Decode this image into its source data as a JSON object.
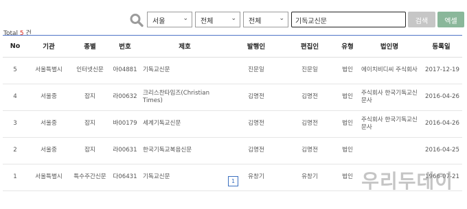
{
  "search": {
    "region": "서울",
    "type1": "전체",
    "type2": "전체",
    "keyword": "기독교신문",
    "search_label": "검색",
    "excel_label": "엑셀"
  },
  "total": {
    "prefix": "Total",
    "count": "5",
    "suffix": "건"
  },
  "columns": [
    "No",
    "기관",
    "종별",
    "번호",
    "제호",
    "발행인",
    "편집인",
    "유형",
    "법인명",
    "등록일"
  ],
  "rows": [
    {
      "no": "5",
      "org": "서울특별시",
      "kind": "인터넷신문",
      "code": "아04881",
      "title": "기독교신문",
      "publisher": "진문일",
      "editor": "진문일",
      "type": "법인",
      "corp": "에이치비디씨 주식회사",
      "date": "2017-12-19"
    },
    {
      "no": "4",
      "org": "서울중",
      "kind": "잡지",
      "code": "라00632",
      "title": "크리스찬타임즈(Christian Times)",
      "publisher": "김명전",
      "editor": "김명전",
      "type": "법인",
      "corp": "주식회사 한국기독교신문사",
      "date": "2016-04-26"
    },
    {
      "no": "3",
      "org": "서울중",
      "kind": "잡지",
      "code": "바00179",
      "title": "세계기독교신문",
      "publisher": "김명전",
      "editor": "김명전",
      "type": "법인",
      "corp": "주식회사 한국기독교신문사",
      "date": "2016-04-26"
    },
    {
      "no": "2",
      "org": "서울중",
      "kind": "잡지",
      "code": "라00631",
      "title": "한국기독교복음신문",
      "publisher": "김명전",
      "editor": "김명전",
      "type": "법인",
      "corp": "",
      "date": "2016-04-25"
    },
    {
      "no": "1",
      "org": "서울특별시",
      "kind": "특수주간신문",
      "code": "다06431",
      "title": "기독교신문",
      "publisher": "유창기",
      "editor": "유창기",
      "type": "법인",
      "corp": "",
      "date": "1966-07-21"
    }
  ],
  "pagination": {
    "current": "1"
  },
  "watermark": "우리두데이",
  "colors": {
    "accent": "#4e73c7",
    "count": "#d9241b",
    "search_btn": "#c6c6c6",
    "excel_btn": "#8ab79a"
  }
}
